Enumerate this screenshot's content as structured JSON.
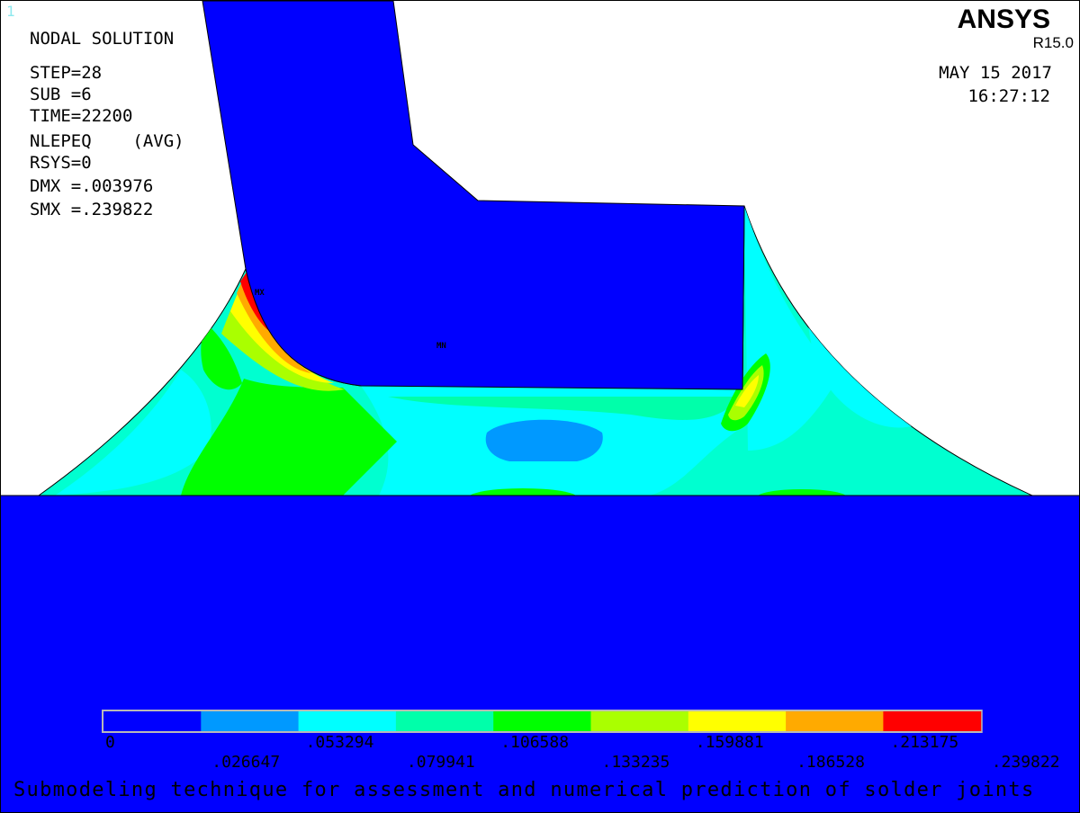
{
  "window_number": "1",
  "brand": {
    "name": "ANSYS",
    "version": "R15.0"
  },
  "timestamp": {
    "date": "MAY 15 2017",
    "time": "16:27:12"
  },
  "info_lines": [
    "NODAL SOLUTION",
    "STEP=28",
    "SUB =6",
    "TIME=22200",
    "NLEPEQ    (AVG)",
    "RSYS=0",
    "DMX =.003976",
    "SMX =.239822"
  ],
  "markers": {
    "max": "MX",
    "min": "MN"
  },
  "legend": {
    "colors": [
      "#0000ff",
      "#0099ff",
      "#00ffff",
      "#00ffaa",
      "#00ff00",
      "#aaff00",
      "#ffff00",
      "#ffaa00",
      "#ff0000"
    ],
    "top_labels": [
      "0",
      ".053294",
      ".106588",
      ".159881",
      ".213175"
    ],
    "bottom_labels": [
      ".026647",
      ".079941",
      ".133235",
      ".186528",
      ".239822"
    ]
  },
  "caption": "Submodeling technique for assessment and numerical prediction of solder joints",
  "colors": {
    "substrate": "#0000ff",
    "lead": "#0000ff",
    "fillet_base": "#00ffd0"
  }
}
